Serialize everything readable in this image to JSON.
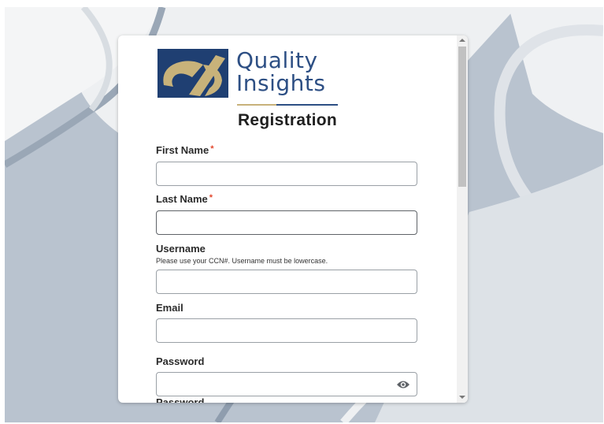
{
  "logo": {
    "line1": "Quality",
    "line2": "Insights",
    "brand_blue": "#2d4f84",
    "brand_gold": "#c8b27a"
  },
  "form": {
    "title": "Registration",
    "required_marker": "*",
    "fields": {
      "first_name": {
        "label": "First Name",
        "value": ""
      },
      "last_name": {
        "label": "Last Name",
        "value": ""
      },
      "username": {
        "label": "Username",
        "hint": "Please use your CCN#. Username must be lowercase.",
        "value": ""
      },
      "email": {
        "label": "Email",
        "value": ""
      },
      "password": {
        "label": "Password",
        "value": ""
      },
      "confirm_password_partial": {
        "label": "Password"
      }
    }
  },
  "icons": {
    "password_toggle": "eye-icon"
  },
  "colors": {
    "background": "#b9c3cf",
    "card": "#ffffff",
    "required": "#e2482d"
  }
}
